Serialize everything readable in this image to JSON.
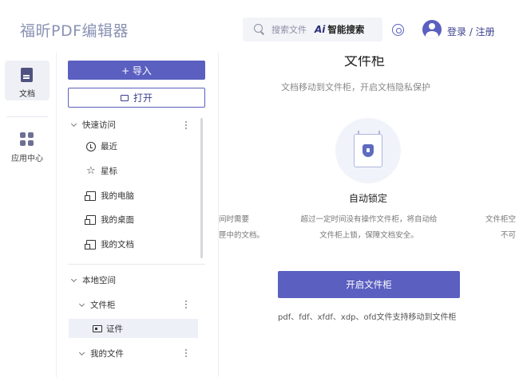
{
  "header": {
    "app_title": "福昕PDF编辑器",
    "search_placeholder": "搜索文件",
    "ai_icon": "Ai",
    "ai_search_label": "智能搜索",
    "login_label": "登录 / 注册",
    "settings_icon": "settings-icon",
    "avatar_icon": "user-avatar-icon"
  },
  "rail": {
    "items": [
      {
        "label": "文档",
        "icon": "document-icon",
        "active": true
      },
      {
        "label": "应用中心",
        "icon": "apps-grid-icon",
        "active": false
      }
    ]
  },
  "panel": {
    "import_label": "+ 导入",
    "open_label": "打开",
    "quick_access": {
      "title": "快速访问",
      "items": [
        {
          "label": "最近",
          "icon": "clock-icon"
        },
        {
          "label": "星标",
          "icon": "star-icon"
        },
        {
          "label": "我的电脑",
          "icon": "computer-icon"
        },
        {
          "label": "我的桌面",
          "icon": "desktop-icon"
        },
        {
          "label": "我的文档",
          "icon": "documents-icon"
        }
      ]
    },
    "local_space": {
      "title": "本地空间",
      "cabinet_label": "文件柜",
      "cabinet_child": "证件",
      "my_files_label": "我的文件"
    }
  },
  "main": {
    "title": "文件柜",
    "subtitle": "文档移动到文件柜，开启文档隐私保护",
    "feature_title": "自动锁定",
    "feature_desc_line1": "超过一定时间没有操作文件柜，将自动给",
    "feature_desc_line2": "文件柜上锁，保障文档安全。",
    "side_left_line1": "间时需要",
    "side_left_line2": "匣中的文档。",
    "side_right_line1": "文件柜空",
    "side_right_line2": "不可",
    "enable_button": "开启文件柜",
    "formats_note": "pdf、fdf、xfdf、xdp、ofd文件支持移动到文件柜"
  },
  "colors": {
    "accent": "#5a5fc0",
    "title_gray": "#8a92b3",
    "selected_row_bg": "#eef0f8"
  }
}
